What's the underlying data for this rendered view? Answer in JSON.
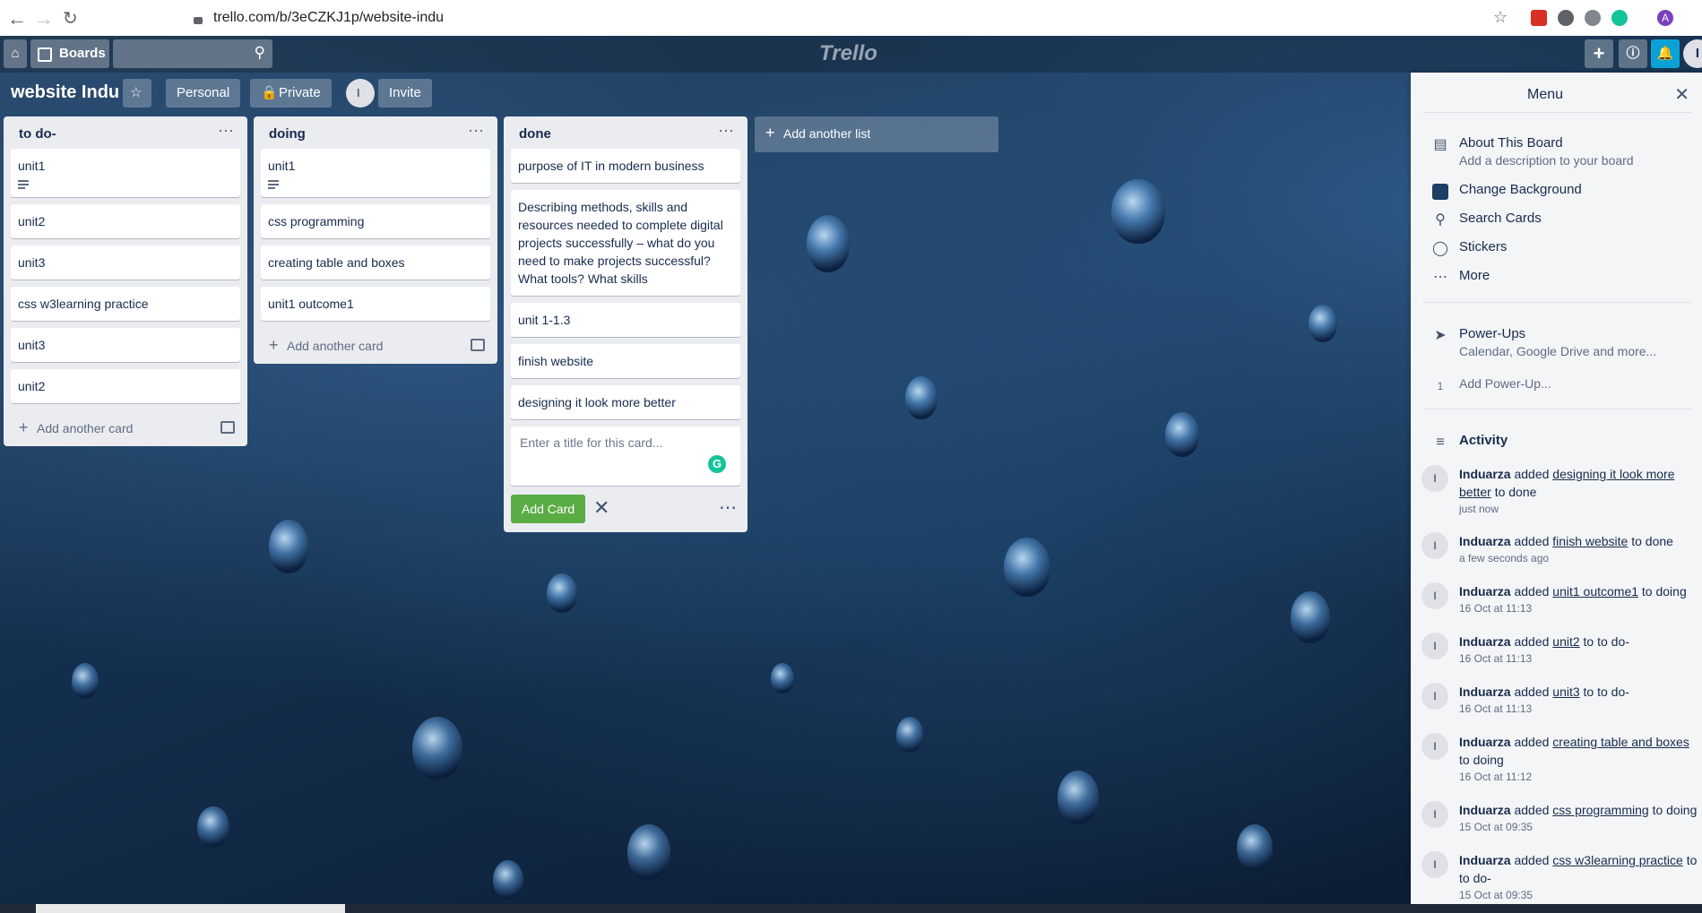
{
  "browser": {
    "url": "trello.com/b/3eCZKJ1p/website-indu"
  },
  "header": {
    "boards_label": "Boards",
    "logo": "Trello"
  },
  "board": {
    "title": "website Indu",
    "personal_label": "Personal",
    "private_label": "Private",
    "member_initial": "I",
    "invite_label": "Invite"
  },
  "lists": [
    {
      "title": "to do-",
      "cards": [
        "unit1",
        "unit2",
        "unit3",
        "css w3learning practice",
        "unit3",
        "unit2"
      ],
      "add_card_label": "Add another card"
    },
    {
      "title": "doing",
      "cards": [
        "unit1",
        "css programming",
        "creating table and boxes",
        "unit1 outcome1"
      ],
      "add_card_label": "Add another card"
    },
    {
      "title": "done",
      "cards": [
        "purpose of IT in modern business",
        "Describing methods, skills and resources needed to complete digital projects successfully – what do you need to make projects successful? What tools? What skills",
        "unit 1-1.3",
        "finish website",
        "designing it look more better"
      ],
      "composer_placeholder": "Enter a title for this card...",
      "add_card_button": "Add Card"
    }
  ],
  "add_list_label": "Add another list",
  "menu": {
    "title": "Menu",
    "about_title": "About This Board",
    "about_sub": "Add a description to your board",
    "change_background": "Change Background",
    "search_cards": "Search Cards",
    "stickers": "Stickers",
    "more": "More",
    "powerups_title": "Power-Ups",
    "powerups_sub": "Calendar, Google Drive and more...",
    "powerup_count": "1",
    "add_powerup": "Add Power-Up...",
    "activity_title": "Activity",
    "activity": [
      {
        "user": "Induarza",
        "verb": "added",
        "link": "designing it look more better",
        "rest": "to done",
        "time": "just now"
      },
      {
        "user": "Induarza",
        "verb": "added",
        "link": "finish website",
        "rest": "to done",
        "time": "a few seconds ago"
      },
      {
        "user": "Induarza",
        "verb": "added",
        "link": "unit1 outcome1",
        "rest": "to doing",
        "time": "16 Oct at 11:13"
      },
      {
        "user": "Induarza",
        "verb": "added",
        "link": "unit2",
        "rest": "to to do-",
        "time": "16 Oct at 11:13"
      },
      {
        "user": "Induarza",
        "verb": "added",
        "link": "unit3",
        "rest": "to to do-",
        "time": "16 Oct at 11:13"
      },
      {
        "user": "Induarza",
        "verb": "added",
        "link": "creating table and boxes",
        "rest": "to doing",
        "time": "16 Oct at 11:12"
      },
      {
        "user": "Induarza",
        "verb": "added",
        "link": "css programming",
        "rest": "to doing",
        "time": "15 Oct at 09:35"
      },
      {
        "user": "Induarza",
        "verb": "added",
        "link": "css w3learning practice",
        "rest": "to to do-",
        "time": "15 Oct at 09:35"
      }
    ]
  }
}
